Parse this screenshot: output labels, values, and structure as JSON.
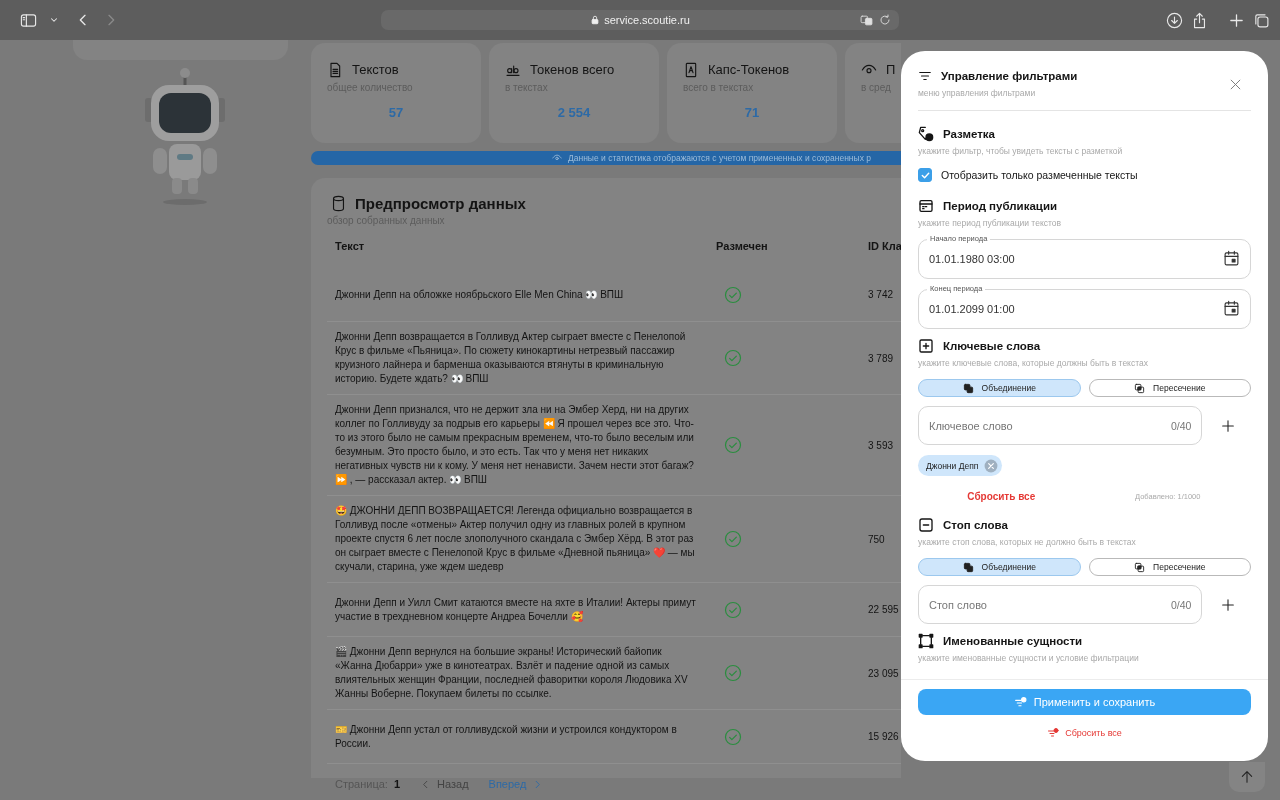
{
  "browser": {
    "url": "service.scoutie.ru"
  },
  "stats": [
    {
      "title": "Текстов",
      "subtitle": "общее количество",
      "value": "57"
    },
    {
      "title": "Токенов всего",
      "subtitle": "в текстах",
      "value": "2 554"
    },
    {
      "title": "Капс-Токенов",
      "subtitle": "всего в текстах",
      "value": "71"
    },
    {
      "title": "П",
      "subtitle": "в сред"
    }
  ],
  "banner": {
    "text": "Данные и статистика отображаются с учетом примененных и сохраненных р"
  },
  "preview": {
    "title": "Предпросмотр данных",
    "subtitle": "обзор собранных данных",
    "columns": [
      "Текст",
      "Размечен",
      "ID Кла"
    ],
    "rows": [
      {
        "text": "Джонни Депп на обложке ноябрьского Elle Men China 👀 ВПШ",
        "marked": true,
        "id": "3 742"
      },
      {
        "text": "Джонни Депп возвращается в Голливуд Актер сыграет вместе с Пенелопой Крус в фильме «Пьяница». По сюжету кинокартины нетрезвый пассажир круизного лайнера и барменша оказываются втянуты в криминальную историю. Будете ждать? 👀 ВПШ",
        "marked": true,
        "id": "3 789"
      },
      {
        "text": "Джонни Депп признался, что не держит зла ни на Эмбер Херд, ни на других коллег по Голливуду за подрыв его карьеры ⏪ Я прошел через все это. Что-то из этого было не самым прекрасным временем, что-то было веселым или безумным. Это просто было, и это есть. Так что у меня нет никаких негативных чувств ни к кому. У меня нет ненависти. Зачем нести этот багаж? ⏩ , — рассказал актер. 👀 ВПШ",
        "marked": true,
        "id": "3 593"
      },
      {
        "text": "🤩 ДЖОННИ ДЕПП ВОЗВРАЩАЕТСЯ! Легенда официально возвращается в Голливуд после «отмены» Актер получил одну из главных ролей в крупном проекте спустя 6 лет после злополучного скандала с Эмбер Хёрд. В этот раз он сыграет вместе с Пенелопой Крус в фильме «Дневной пьяница» ❤️ — мы скучали, старина, уже ждем шедевр",
        "marked": true,
        "id": "750"
      },
      {
        "text": "Джонни Депп и Уилл Смит катаются вместе на яхте в Италии! Актеры примут участие в трехдневном концерте Андреа Бочелли 🥰",
        "marked": true,
        "id": "22 595"
      },
      {
        "text": "🎬 Джонни Депп вернулся на большие экраны! Исторический байопик «Жанна Дюбарри» уже в кинотеатрах. Взлёт и падение одной из самых влиятельных женщин Франции, последней фаворитки короля Людовика XV Жанны Воберне. Покупаем билеты по ссылке.",
        "marked": true,
        "id": "23 095"
      },
      {
        "text": "🎫 Джонни Депп устал от голливудской жизни и устроился кондуктором в России.",
        "marked": true,
        "id": "15 926"
      }
    ],
    "pagination": {
      "page_label": "Страница:",
      "page": "1",
      "prev": "Назад",
      "prev_disabled": true,
      "next": "Вперед"
    }
  },
  "filters_panel": {
    "title": "Управление фильтрами",
    "subtitle": "меню управления фильтрами",
    "markup": {
      "title": "Разметка",
      "subtitle": "укажите фильтр, чтобы увидеть тексты с разметкой",
      "checkbox": {
        "label": "Отобразить только размеченные тексты",
        "checked": true
      }
    },
    "period": {
      "title": "Период публикации",
      "subtitle": "укажите период публикации текстов",
      "fields": [
        {
          "label": "Начало периода",
          "value": "01.01.1980 03:00"
        },
        {
          "label": "Конец периода",
          "value": "01.01.2099 01:00"
        }
      ]
    },
    "keywords": {
      "title": "Ключевые слова",
      "subtitle": "укажите ключевые слова, которые должны быть в текстах",
      "modes": [
        {
          "label": "Объединение",
          "selected": true
        },
        {
          "label": "Пересечение",
          "selected": false
        }
      ],
      "input": {
        "placeholder": "Ключевое слово",
        "counter": "0/40"
      },
      "chips": [
        "Джонни Депп"
      ],
      "reset": "Сбросить все",
      "added": "Добавлено: 1/1000"
    },
    "stopwords": {
      "title": "Стоп слова",
      "subtitle": "укажите стоп слова, которых не должно быть в текстах",
      "modes": [
        {
          "label": "Объединение",
          "selected": true
        },
        {
          "label": "Пересечение",
          "selected": false
        }
      ],
      "input": {
        "placeholder": "Стоп слово",
        "counter": "0/40"
      }
    },
    "entities": {
      "title": "Именованные сущности",
      "subtitle": "укажите именованные сущности и условие фильтрации"
    },
    "apply": "Применить и сохранить",
    "reset_all": "Сбросить все"
  }
}
